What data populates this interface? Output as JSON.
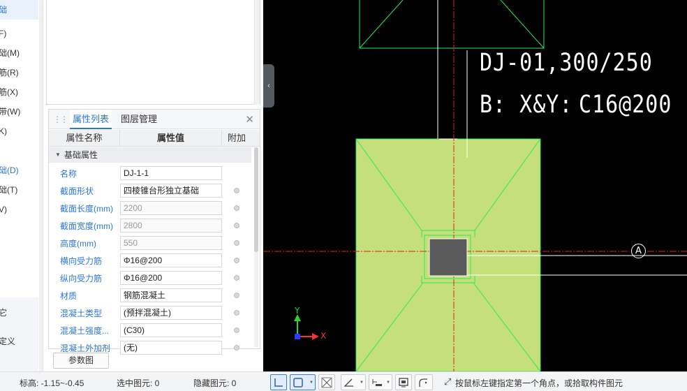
{
  "left_nav": {
    "items": [
      {
        "label": "础",
        "active": true
      },
      {
        "label": "F)"
      },
      {
        "label": "础(M)"
      },
      {
        "label": "筋(R)"
      },
      {
        "label": "筋(X)"
      },
      {
        "label": "带(W)"
      },
      {
        "label": "K)"
      },
      {
        "label": "础(D)",
        "active": true
      },
      {
        "label": "础(T)"
      },
      {
        "label": "V)"
      },
      {
        "label": "它"
      },
      {
        "label": "定义"
      }
    ]
  },
  "property_panel": {
    "tabs": [
      "属性列表",
      "图层管理"
    ],
    "columns": [
      "属性名称",
      "属性值",
      "附加"
    ],
    "group": "基础属性",
    "rows": [
      {
        "name": "名称",
        "value": "DJ-1-1",
        "disabled": false
      },
      {
        "name": "截面形状",
        "value": "四棱锥台形独立基础",
        "disabled": false
      },
      {
        "name": "截面长度(mm)",
        "value": "2200",
        "disabled": true
      },
      {
        "name": "截面宽度(mm)",
        "value": "2800",
        "disabled": true
      },
      {
        "name": "高度(mm)",
        "value": "550",
        "disabled": true
      },
      {
        "name": "横向受力筋",
        "value": "Φ16@200",
        "disabled": false
      },
      {
        "name": "纵向受力筋",
        "value": "Φ16@200",
        "disabled": false
      },
      {
        "name": "材质",
        "value": "钢筋混凝土",
        "disabled": false
      },
      {
        "name": "混凝土类型",
        "value": "(预拌混凝土)",
        "disabled": false
      },
      {
        "name": "混凝土强度...",
        "value": "(C30)",
        "disabled": false
      },
      {
        "name": "混凝土外加剂",
        "value": "(无)",
        "disabled": false
      }
    ],
    "param_button": "参数图"
  },
  "canvas": {
    "label_line1": "DJ-01,300/250",
    "label_line2_a": "B: X&Y:",
    "label_line2_b": "C16@200",
    "axis_label": "A",
    "y_axis": "Y",
    "x_axis": "X",
    "colors": {
      "background": "#000000",
      "foundation_fill": "#c5e07a",
      "outline": "#2be85a",
      "column": "#5a5a5a",
      "axis_line": "#e02020"
    }
  },
  "status_bar": {
    "elevation": "标高:  -1.15~-0.45",
    "selected": "选中图元:  0",
    "hidden": "隐藏图元:  0",
    "hint": "按鼠标左键指定第一个角点，或拾取构件图元",
    "tools": [
      "ortho-icon",
      "rect-select-icon",
      "cross-icon",
      "angle-icon",
      "dimension-icon",
      "screen-icon",
      "curve-icon"
    ]
  }
}
